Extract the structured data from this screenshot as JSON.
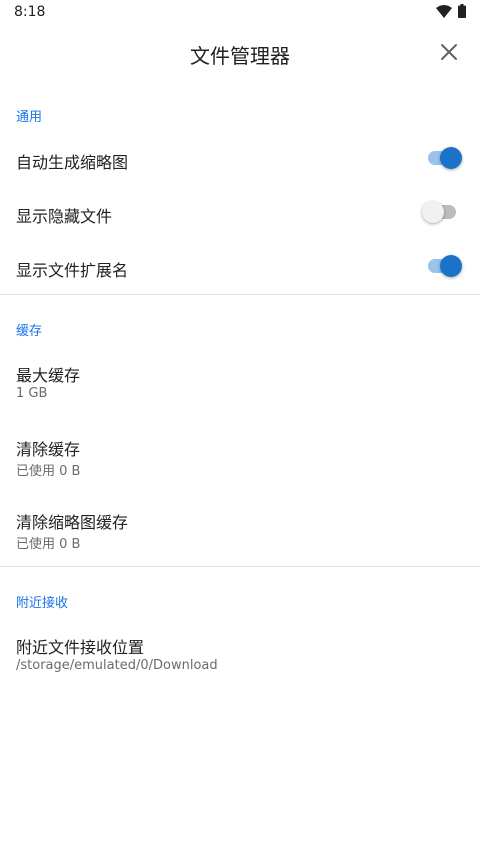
{
  "status_bar": {
    "time": "8:18",
    "icons": [
      "wifi-icon",
      "battery-icon"
    ]
  },
  "app_bar": {
    "title": "文件管理器",
    "close_icon": "close-icon"
  },
  "sections": {
    "general": {
      "header": "通用",
      "items": [
        {
          "title": "自动生成缩略图",
          "toggle": true
        },
        {
          "title": "显示隐藏文件",
          "toggle": false
        },
        {
          "title": "显示文件扩展名",
          "toggle": true
        }
      ]
    },
    "cache": {
      "header": "缓存",
      "items": [
        {
          "title": "最大缓存",
          "subtitle": "1 GB"
        },
        {
          "title": "清除缓存",
          "subtitle": "已使用 0 B"
        },
        {
          "title": "清除缩略图缓存",
          "subtitle": "已使用 0 B"
        }
      ]
    },
    "nearby": {
      "header": "附近接收",
      "items": [
        {
          "title": "附近文件接收位置",
          "subtitle": "/storage/emulated/0/Download"
        }
      ]
    }
  },
  "colors": {
    "accent": "#1a73e8",
    "switch_on": "#1a73c8",
    "switch_off_track": "#bdbdbd"
  }
}
